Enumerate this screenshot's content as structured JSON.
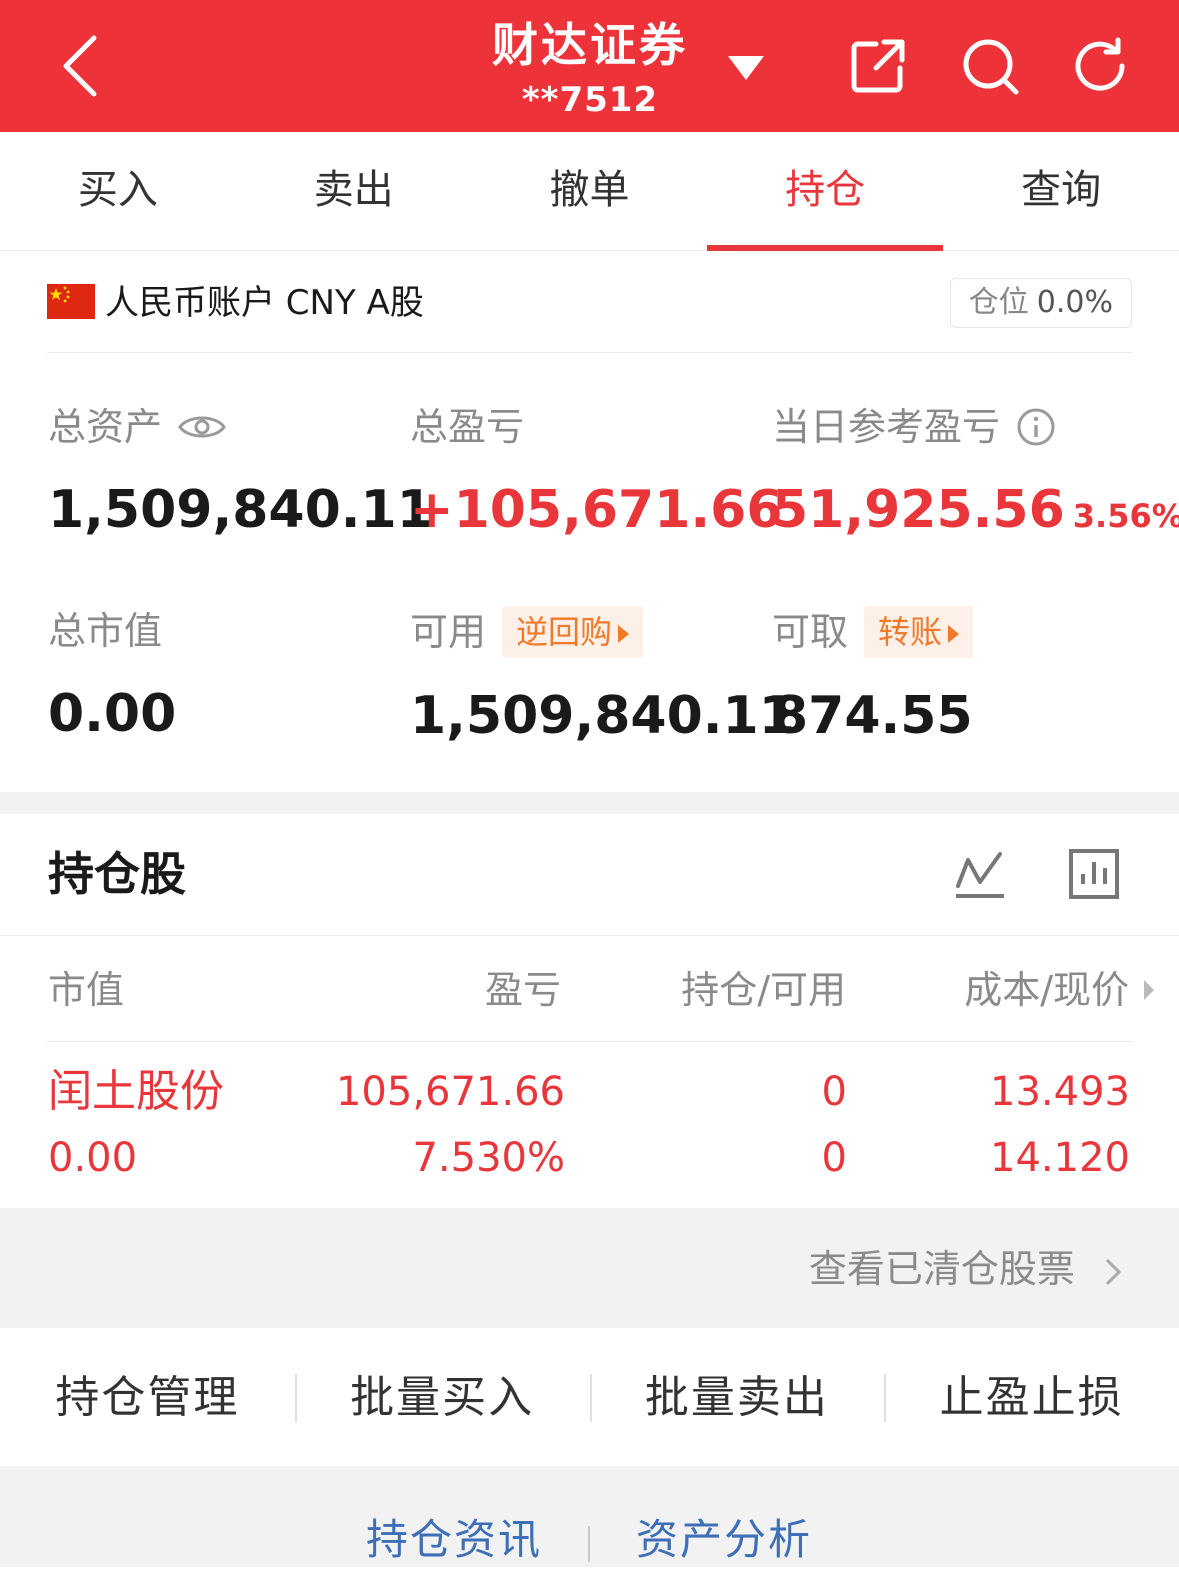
{
  "header": {
    "title": "财达证券",
    "account": "**7512",
    "icons": [
      "back-icon",
      "dropdown-caret-icon",
      "share-icon",
      "search-icon",
      "refresh-icon"
    ]
  },
  "tabs": [
    {
      "label": "买入",
      "active": false
    },
    {
      "label": "卖出",
      "active": false
    },
    {
      "label": "撤单",
      "active": false
    },
    {
      "label": "持仓",
      "active": true
    },
    {
      "label": "查询",
      "active": false
    }
  ],
  "account_row": {
    "flag": "china-flag-icon",
    "label": "人民币账户 CNY A股",
    "position_label": "仓位",
    "position_value": "0.0%"
  },
  "assets": {
    "total_assets": {
      "label": "总资产",
      "value": "1,509,840.11"
    },
    "total_pnl": {
      "label": "总盈亏",
      "value": "+105,671.66"
    },
    "daily_pnl": {
      "label": "当日参考盈亏",
      "value": "51,925.56",
      "pct": "3.56%"
    },
    "market_value": {
      "label": "总市值",
      "value": "0.00"
    },
    "available": {
      "label": "可用",
      "value": "1,509,840.11",
      "button": "逆回购"
    },
    "withdrawable": {
      "label": "可取",
      "value": "874.55",
      "button": "转账"
    }
  },
  "holdings": {
    "title": "持仓股",
    "columns": [
      "市值",
      "盈亏",
      "持仓/可用",
      "成本/现价"
    ],
    "rows": [
      {
        "name": "闰土股份",
        "market_value": "0.00",
        "pnl": "105,671.66",
        "pnl_pct": "7.530%",
        "holding": "0",
        "available": "0",
        "cost": "13.493",
        "price": "14.120"
      }
    ],
    "view_cleared": "查看已清仓股票"
  },
  "actions": [
    "持仓管理",
    "批量买入",
    "批量卖出",
    "止盈止损"
  ],
  "footer_links": [
    "持仓资讯",
    "资产分析"
  ],
  "colors": {
    "brand_red": "#ee3239",
    "profit_red": "#e8363b",
    "accent_orange": "#f07a2a",
    "link_blue": "#3d6fb8"
  }
}
